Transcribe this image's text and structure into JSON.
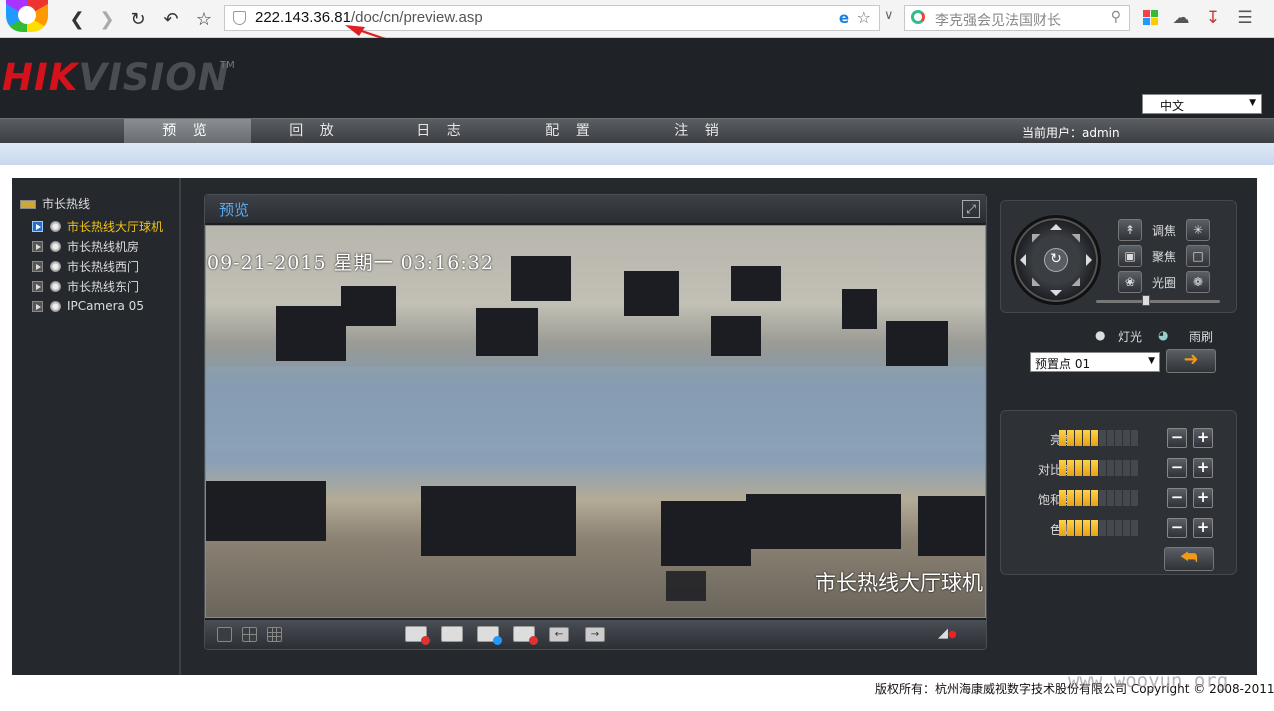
{
  "browser": {
    "url_host": "222.143.36.81",
    "url_path": "/doc/cn/preview.asp",
    "search_text": "李克强会见法国财长",
    "icons": [
      "back-icon",
      "forward-icon",
      "refresh-icon",
      "undo-icon",
      "star-icon",
      "shield-icon",
      "ie-icon",
      "search-icon",
      "windows-icon",
      "cloud-icon",
      "download-icon",
      "menu-icon"
    ]
  },
  "header": {
    "logo_red": "HIK",
    "logo_gray": "VISION",
    "logo_tm": "TM",
    "language": "中文"
  },
  "nav": {
    "items": [
      "预 览",
      "回 放",
      "日 志",
      "配 置",
      "注 销"
    ],
    "active_index": 0,
    "current_user": "当前用户：admin"
  },
  "tree": {
    "root": "市长热线",
    "cameras": [
      "市长热线大厅球机",
      "市长热线机房",
      "市长热线西门",
      "市长热线东门",
      "IPCamera 05"
    ],
    "active_index": 0
  },
  "preview": {
    "title": "预览",
    "osd_time": "09-21-2015 星期一 03:16:32",
    "osd_name": "市长热线大厅球机"
  },
  "ptz": {
    "rows": [
      {
        "label": "调焦"
      },
      {
        "label": "聚焦"
      },
      {
        "label": "光圈"
      }
    ],
    "speed": 0.4,
    "light_label": "灯光",
    "wiper_label": "雨刷",
    "preset": "预置点 01"
  },
  "image": {
    "rows": [
      {
        "label": "亮度",
        "level": 5,
        "max": 10
      },
      {
        "label": "对比度",
        "level": 5,
        "max": 10
      },
      {
        "label": "饱和度",
        "level": 5,
        "max": 10
      },
      {
        "label": "色调",
        "level": 5,
        "max": 10
      }
    ]
  },
  "footer": {
    "copyright": "版权所有：杭州海康威视数字技术股份有限公司 Copyright © 2008-2011"
  },
  "watermark": "www.wooyun.org",
  "colors": {
    "accent_blue": "#56aaf2",
    "active_yellow": "#f2c317",
    "logo_red": "#d5121b",
    "video_border": "#22d222"
  }
}
